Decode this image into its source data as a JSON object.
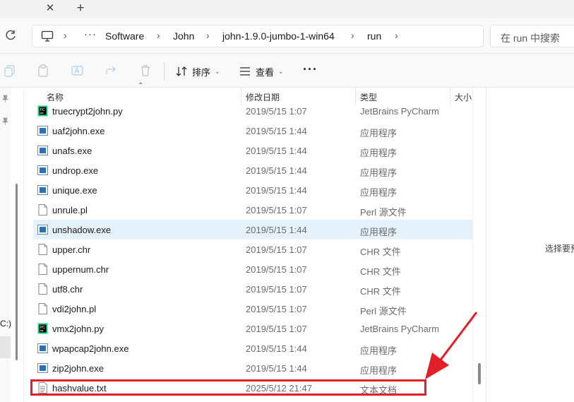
{
  "tabstrip": {
    "close_glyph": "✕",
    "add_glyph": "+"
  },
  "address": {
    "ellipsis": "···",
    "crumbs": [
      "Software",
      "John",
      "john-1.9.0-jumbo-1-win64",
      "run"
    ],
    "separator": "›",
    "search_placeholder": "在 run 中搜索"
  },
  "commandbar": {
    "sort_label": "排序",
    "view_label": "查看",
    "more_label": "···",
    "icons": [
      "copy-icon",
      "paste-icon",
      "rename-icon",
      "share-icon",
      "delete-icon"
    ]
  },
  "columns": {
    "name": "名称",
    "modified": "修改日期",
    "type": "类型",
    "size": "大小"
  },
  "nav": {
    "drive_label": "C:)"
  },
  "files": [
    {
      "name": "truecrypt2john.py",
      "date": "2019/5/15 1:07",
      "type": "JetBrains PyCharm",
      "icon": "pycharm"
    },
    {
      "name": "uaf2john.exe",
      "date": "2019/5/15 1:44",
      "type": "应用程序",
      "icon": "exe"
    },
    {
      "name": "unafs.exe",
      "date": "2019/5/15 1:44",
      "type": "应用程序",
      "icon": "exe"
    },
    {
      "name": "undrop.exe",
      "date": "2019/5/15 1:44",
      "type": "应用程序",
      "icon": "exe"
    },
    {
      "name": "unique.exe",
      "date": "2019/5/15 1:44",
      "type": "应用程序",
      "icon": "exe"
    },
    {
      "name": "unrule.pl",
      "date": "2019/5/15 1:07",
      "type": "Perl 源文件",
      "icon": "file"
    },
    {
      "name": "unshadow.exe",
      "date": "2019/5/15 1:44",
      "type": "应用程序",
      "icon": "exe",
      "selected": true
    },
    {
      "name": "upper.chr",
      "date": "2019/5/15 1:07",
      "type": "CHR 文件",
      "icon": "file"
    },
    {
      "name": "uppernum.chr",
      "date": "2019/5/15 1:07",
      "type": "CHR 文件",
      "icon": "file"
    },
    {
      "name": "utf8.chr",
      "date": "2019/5/15 1:07",
      "type": "CHR 文件",
      "icon": "file"
    },
    {
      "name": "vdi2john.pl",
      "date": "2019/5/15 1:07",
      "type": "Perl 源文件",
      "icon": "file"
    },
    {
      "name": "vmx2john.py",
      "date": "2019/5/15 1:07",
      "type": "JetBrains PyCharm",
      "icon": "pycharm"
    },
    {
      "name": "wpapcap2john.exe",
      "date": "2019/5/15 1:44",
      "type": "应用程序",
      "icon": "exe"
    },
    {
      "name": "zip2john.exe",
      "date": "2019/5/15 1:44",
      "type": "应用程序",
      "icon": "exe"
    },
    {
      "name": "hashvalue.txt",
      "date": "2025/5/12 21:47",
      "type": "文本文档",
      "icon": "text"
    }
  ],
  "preview": {
    "text": "选择要预"
  },
  "colors": {
    "annotation": "#e21f26",
    "selected_row": "#e5f1fb"
  }
}
